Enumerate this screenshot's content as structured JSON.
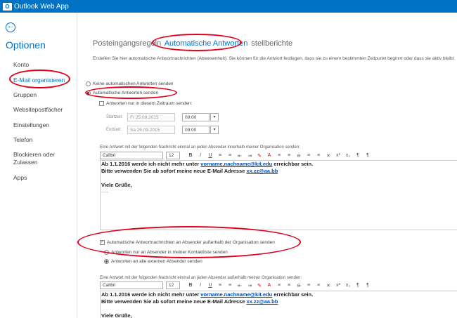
{
  "app": {
    "logo_glyph": "O",
    "title": "Outlook Web App",
    "brand_color": "#0072c6"
  },
  "sidebar": {
    "back_icon": "back-arrow-icon",
    "title": "Optionen",
    "items": [
      {
        "label": "Konto"
      },
      {
        "label": "E-Mail organisieren",
        "selected": true
      },
      {
        "label": "Gruppen"
      },
      {
        "label": "Websitepostfächer"
      },
      {
        "label": "Einstellungen"
      },
      {
        "label": "Telefon"
      },
      {
        "label": "Blockieren oder"
      },
      {
        "label": "Zulassen"
      },
      {
        "label": "Apps"
      }
    ]
  },
  "tabs": [
    {
      "label": "Posteingangsregeln"
    },
    {
      "label": "Automatische Antworten",
      "active": true
    },
    {
      "label": "stellberichte"
    }
  ],
  "intro": "Erstellen Sie hier automatische Antwortnachrichten (Abwesenheit). Sie können für die Antwort festlegen, dass sie zu einem bestimmten Zeitpunkt beginnt oder dass sie aktiv bleibt",
  "options": {
    "no_replies": "Keine automatischen Antworten senden",
    "send_replies": "Automatische Antworten senden",
    "period_only": "Antworten nur in diesem Zeitraum senden:",
    "start_label": "Startzeit:",
    "start_date": "Fr 25.09.2015",
    "start_time": "09:00",
    "end_label": "Endzeit:",
    "end_date": "Sa 26.09.2015",
    "end_time": "09:00",
    "dropdown_glyph": "▾"
  },
  "internal": {
    "label": "Eine Antwort mit der folgenden Nachricht einmal an jeden Absender innerhalb meiner Organisation senden:",
    "font": "Calibri",
    "size": "12",
    "line1_pre": "Ab 1.1.2016 werde ich nicht mehr unter ",
    "line1_link": "vorname.nachname@kit.edu",
    "line1_post": " erreichbar sein.",
    "line2_pre": "Bitte verwenden Sie ab sofort meine neue E-Mail Adresse ",
    "line2_link": "xx.zz@aa.bb",
    "greeting": "Viele Grüße,",
    "sig": "----"
  },
  "external": {
    "checkbox": "Automatische Antwortnachrichten an Absender außerhalb der Organisation senden",
    "contacts_only": "Antworten nur an Absender in meiner Kontaktliste senden",
    "all_external": "Antworten an alle externen Absender senden",
    "label": "Eine Antwort mit der folgenden Nachricht einmal an jeden Absender außerhalb meiner Organisation senden:",
    "font": "Calibri",
    "size": "12",
    "line1_pre": "Ab 1.1.2016 werde ich nicht mehr unter ",
    "line1_link": "vorname.nachname@kit.edu",
    "line1_post": " erreichbar sein.",
    "line2_pre": "Bitte verwenden Sie ab sofort meine neue E-Mail Adresse ",
    "line2_link": "xx.zz@aa.bb",
    "greeting": "Viele Grüße,"
  },
  "toolbar_glyphs": [
    "B",
    "I",
    "U",
    "≡",
    "≡",
    "⇤",
    "⇥",
    "✎",
    "A",
    "≡",
    "≡",
    "⊖",
    "≡",
    "≡",
    "✕",
    "x²",
    "x₂",
    "¶",
    "¶"
  ],
  "annotation_color": "#e0001b"
}
